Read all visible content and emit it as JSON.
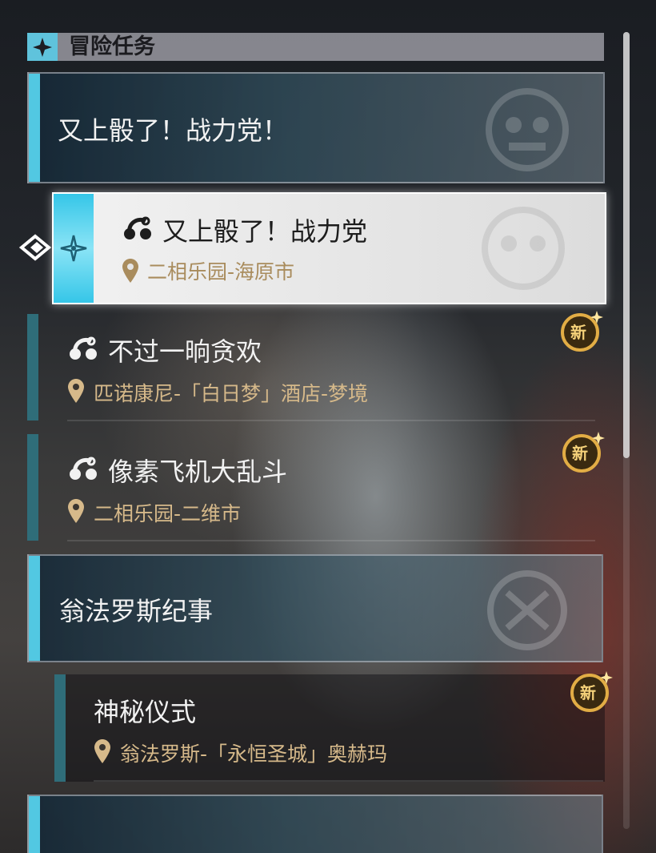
{
  "header": {
    "title": "冒险任务"
  },
  "groups": [
    {
      "title": "又上骰了！战力党！"
    },
    {
      "title": "翁法罗斯纪事"
    }
  ],
  "selected_quest": {
    "title": "又上骰了！战力党",
    "location": "二相乐园-海原市"
  },
  "quests": [
    {
      "title": "不过一晌贪欢",
      "location": "匹诺康尼-「白日梦」酒店-梦境",
      "badge": "新"
    },
    {
      "title": "像素飞机大乱斗",
      "location": "二相乐园-二维市",
      "badge": "新"
    },
    {
      "title": "神秘仪式",
      "location": "翁法罗斯-「永恒圣城」奥赫玛",
      "badge": "新"
    }
  ],
  "colors": {
    "accent": "#52c8e2",
    "location_text": "#d6b98a",
    "badge": "#d9a23a"
  },
  "icons": [
    "star-emblem-icon",
    "quest-node-icon",
    "location-pin-icon",
    "new-badge-icon",
    "selection-pointer-icon"
  ]
}
